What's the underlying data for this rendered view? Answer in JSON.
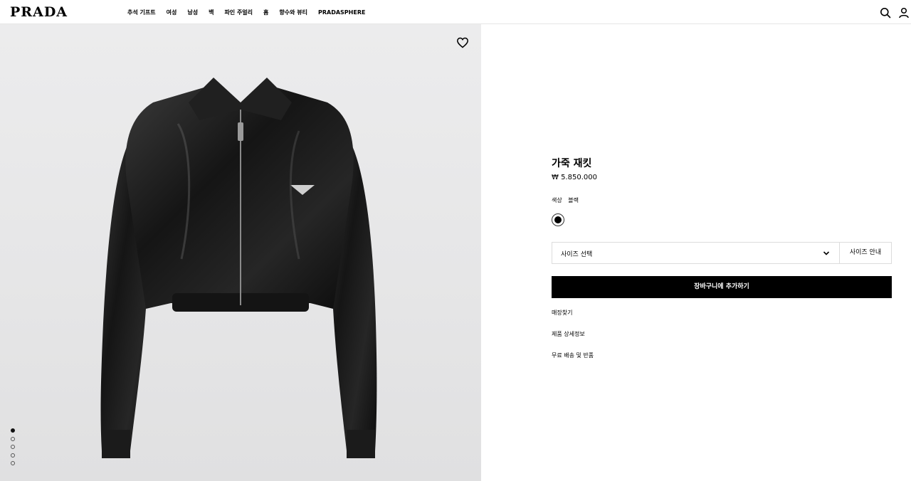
{
  "header": {
    "logo": "PRADA",
    "nav": [
      "추석 기프트",
      "여성",
      "남성",
      "백",
      "파인 주얼리",
      "홈",
      "향수와 뷰티",
      "PRADASPHERE"
    ],
    "icons": [
      "search-icon",
      "user-icon"
    ]
  },
  "gallery": {
    "image_name": "leather-jacket-photo",
    "wishlist_icon": "heart-icon",
    "slide_count": 5,
    "active_slide": 1
  },
  "product": {
    "title": "가죽 재킷",
    "price": "₩ 5.850.000",
    "color_label": "색상",
    "color_value": "블랙",
    "size_select_label": "사이즈 선택",
    "size_guide_label": "사이즈 안내",
    "add_to_cart_label": "장바구니에 추가하기",
    "links": [
      "매장찾기",
      "제품 상세정보",
      "무료 배송 및 반품"
    ]
  },
  "colors": {
    "accent": "#000000",
    "background_right": "#ffffff",
    "background_left": "#e8e8e9"
  }
}
